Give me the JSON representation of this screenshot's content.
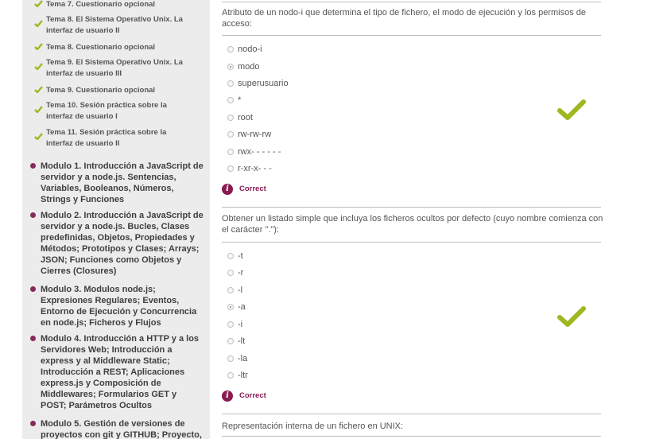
{
  "sidebar": {
    "sub_items": [
      {
        "label": "Tema 7. Cuestionario opcional"
      },
      {
        "label": "Tema 8. El Sistema Operativo Unix. La interfaz de usuario II"
      },
      {
        "label": "Tema 8. Cuestionario opcional"
      },
      {
        "label": "Tema 9. El Sistema Operativo Unix. La interfaz de usuario III"
      },
      {
        "label": "Tema 9. Cuestionario opcional"
      },
      {
        "label": "Tema 10. Sesión práctica sobre la interfaz de usuario I"
      },
      {
        "label": "Tema 11. Sesión práctica sobre la interfaz de usuario II"
      }
    ],
    "modules": [
      {
        "label": "Modulo 1. Introducción a JavaScript de servidor y a node.js. Sentencias, Variables, Booleanos, Números, Strings y Funciones"
      },
      {
        "label": "Modulo 2. Introducción a JavaScript de servidor y a node.js. Bucles, Clases predefinidas, Objetos, Propiedades y Métodos; Prototipos y Clases; Arrays; JSON; Funciones como Objetos y Cierres (Closures)"
      },
      {
        "label": "Modulo 3. Modulos node.js; Expresiones Regulares; Eventos, Entorno de Ejecución y Concurrencia en node.js; Ficheros y Flujos"
      },
      {
        "label": "Modulo 4. Introducción a HTTP y a los Servidores Web; Introducción a express y al Middleware Static; Introducción a REST; Aplicaciones express.js y Composición de Middlewares; Formularios GET y POST; Parámetros Ocultos"
      },
      {
        "label": "Modulo 5. Gestión de versiones de proyectos con git y GITHUB; Proyecto,"
      }
    ]
  },
  "questions": [
    {
      "text": "Atributo de un nodo-i que determina el tipo de fichero, el modo de ejecución y los permisos de acceso:",
      "options": [
        "nodo-i",
        "modo",
        "superusuario",
        "*",
        "root",
        "rw-rw-rw",
        "rwx- - - - - -",
        "r-xr-x- - -"
      ],
      "selected_index": 1,
      "feedback": "Correct"
    },
    {
      "text": "Obtener un listado simple que incluya los ficheros ocultos por defecto (cuyo nombre comienza con el carácter \".\"):",
      "options": [
        "-t",
        "-r",
        "-l",
        "-a",
        "-i",
        "-lt",
        "-la",
        "-ltr"
      ],
      "selected_index": 3,
      "feedback": "Correct"
    },
    {
      "text": "Representación interna de un fichero en UNIX:"
    }
  ],
  "colors": {
    "check_green": "#9fb81f",
    "accent_magenta": "#8a1a52",
    "sidebar_bg": "#ececec"
  },
  "icons": {
    "sub_item": "check-icon",
    "module": "bullet-icon",
    "feedback": "info-icon",
    "result": "correct-check-icon"
  }
}
